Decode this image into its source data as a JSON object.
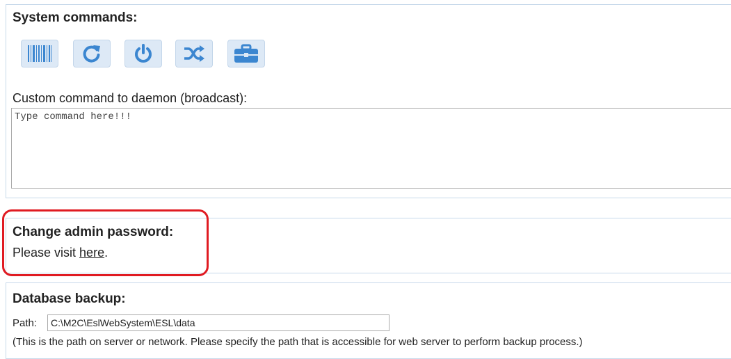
{
  "system_commands": {
    "title": "System commands:",
    "buttons": [
      {
        "icon": "barcode-icon"
      },
      {
        "icon": "refresh-icon"
      },
      {
        "icon": "power-icon"
      },
      {
        "icon": "shuffle-icon"
      },
      {
        "icon": "briefcase-icon"
      }
    ],
    "custom_command_label": "Custom command to daemon (broadcast):",
    "custom_command_placeholder": "Type command here!!!",
    "custom_command_value": ""
  },
  "admin_password": {
    "title": "Change admin password:",
    "text_before": "Please visit ",
    "link_text": "here",
    "text_after": "."
  },
  "database_backup": {
    "title": "Database backup:",
    "path_label": "Path:",
    "path_value": "C:\\M2C\\EslWebSystem\\ESL\\data",
    "path_note": "(This is the path on server or network. Please specify the path that is accessible for web server to perform backup process.)"
  },
  "colors": {
    "accent": "#3b86d0",
    "button_bg": "#dde9f6",
    "panel_border": "#c7d9ea",
    "highlight": "#e01b22"
  }
}
